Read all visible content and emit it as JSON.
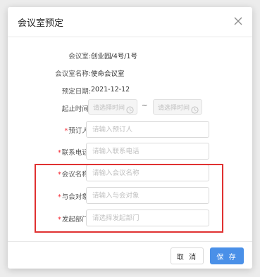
{
  "dialog": {
    "title": "会议室预定",
    "close_icon": "close-icon"
  },
  "form": {
    "room": {
      "label": "会议室:",
      "value": "创业园/4号/1号"
    },
    "room_name": {
      "label": "会议室名称:",
      "value": "使命会议室"
    },
    "booking_date": {
      "label": "预定日期:",
      "value": "2021-12-12"
    },
    "time_range": {
      "label": "起止时间:",
      "start_placeholder": "请选择时间",
      "end_placeholder": "请选择时间",
      "separator": "~",
      "clock_icon": "clock-icon"
    },
    "booker": {
      "required_mark": "*",
      "label": "预订人:",
      "placeholder": "请输入预订人"
    },
    "phone": {
      "required_mark": "*",
      "label": "联系电话:",
      "placeholder": "请输入联系电话"
    },
    "meeting_name": {
      "required_mark": "*",
      "label": "会议名称:",
      "placeholder": "请输入会议名称"
    },
    "participants": {
      "required_mark": "*",
      "label": "与会对象:",
      "placeholder": "请输入与会对象"
    },
    "department": {
      "required_mark": "*",
      "label": "发起部门:",
      "placeholder": "请选择发起部门"
    }
  },
  "footer": {
    "cancel_label": "取 消",
    "save_label": "保 存"
  },
  "colors": {
    "primary": "#4a90e8",
    "required": "#f5222d",
    "highlight_box": "#e03131"
  }
}
